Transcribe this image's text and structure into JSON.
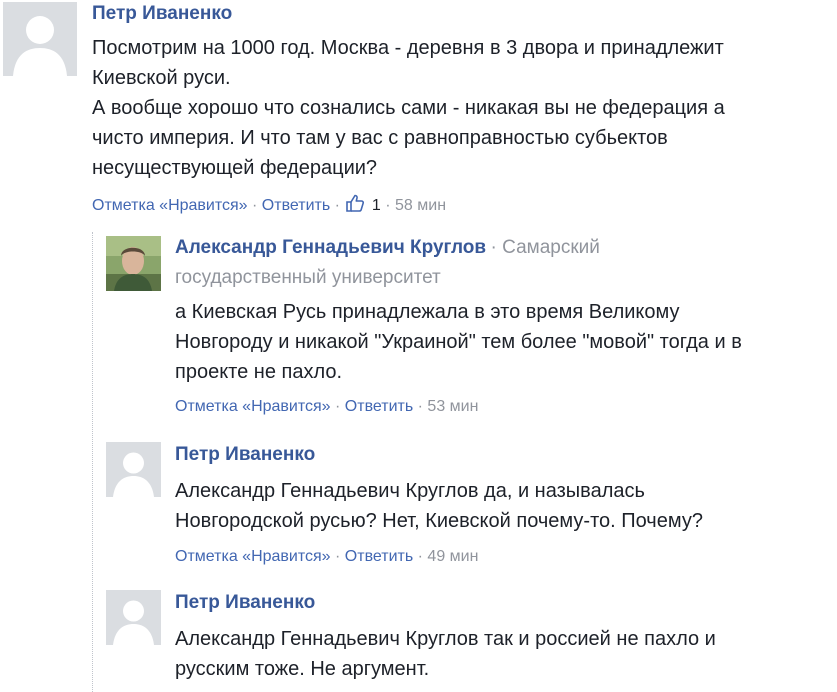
{
  "comments": [
    {
      "author": "Петр Иваненко",
      "lines": [
        "Посмотрим на 1000 год. Москва - деревня в 3 двора и принадлежит",
        "Киевской руси.",
        "А вообще хорошо что сознались сами - никакая вы не федерация а",
        "чисто империя. И что там у вас с равноправностью субьектов",
        "несуществующей федерации?"
      ],
      "like_label": "Отметка «Нравится»",
      "reply_label": "Ответить",
      "likes": "1",
      "time": "58 мин",
      "avatar": "default-avatar-icon"
    },
    {
      "author": "Александр Геннадьевич Круглов",
      "affiliation_line1": "Самарский",
      "affiliation_line2": "государственный университет",
      "lines": [
        "а Киевская Русь принадлежала в это время Великому",
        "Новгороду и никакой \"Украиной\" тем более \"мовой\" тогда и в",
        "проекте не пахло."
      ],
      "like_label": "Отметка «Нравится»",
      "reply_label": "Ответить",
      "time": "53 мин",
      "avatar": "user-photo"
    },
    {
      "author": "Петр Иваненко",
      "lines": [
        "Александр Геннадьевич Круглов да, и называлась",
        "Новгородской русью? Нет, Киевской почему-то. Почему?"
      ],
      "like_label": "Отметка «Нравится»",
      "reply_label": "Ответить",
      "time": "49 мин",
      "avatar": "default-avatar-icon"
    },
    {
      "author": "Петр Иваненко",
      "lines": [
        "Александр Геннадьевич Круглов так и россией не пахло и",
        "русским тоже. Не аргумент."
      ],
      "avatar": "default-avatar-icon"
    }
  ],
  "separator": "·",
  "colors": {
    "link": "#4267b2",
    "author": "#385898",
    "meta": "#90949c",
    "text": "#1d2129",
    "avatar_bg": "#dadde1"
  }
}
